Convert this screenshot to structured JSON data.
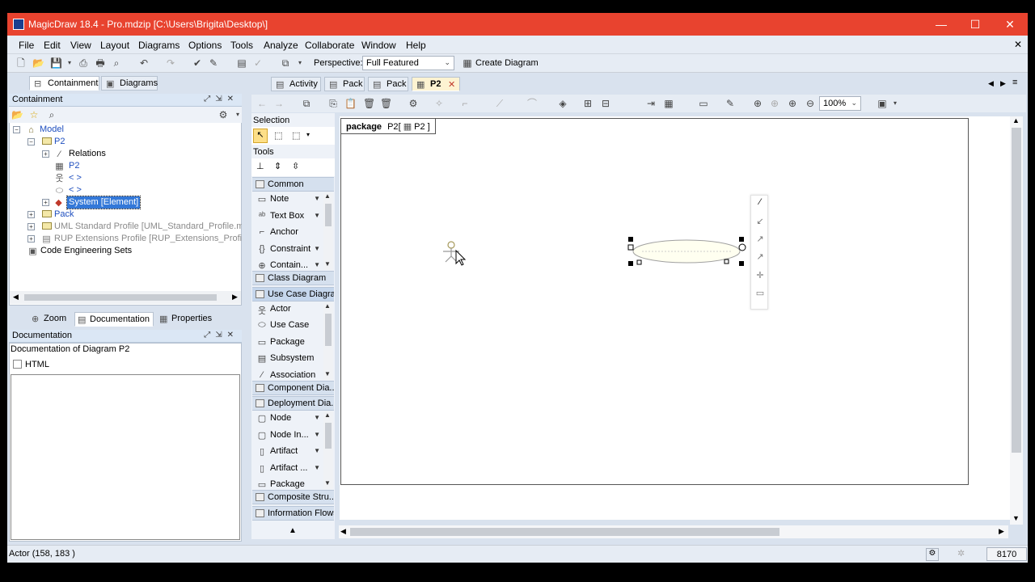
{
  "window": {
    "title": "MagicDraw 18.4 - Pro.mdzip [C:\\Users\\Brigita\\Desktop\\]",
    "minimize": "—",
    "maximize": "☐",
    "close": "✕"
  },
  "menubar": {
    "items": [
      "File",
      "Edit",
      "View",
      "Layout",
      "Diagrams",
      "Options",
      "Tools",
      "Analyze",
      "Collaborate",
      "Window",
      "Help"
    ],
    "close": "✕"
  },
  "toolbar": {
    "perspective_label": "Perspective:",
    "perspective_value": "Full Featured",
    "create_diagram_label": "Create Diagram"
  },
  "left_tabs": {
    "containment": "Containment",
    "diagrams": "Diagrams"
  },
  "containment": {
    "header": "Containment",
    "tree": [
      {
        "label": "Model"
      },
      {
        "label": "P2"
      },
      {
        "label": "Relations"
      },
      {
        "label": "P2"
      },
      {
        "label": "< >"
      },
      {
        "label": "< >"
      },
      {
        "label": "System [Element]"
      },
      {
        "label": "Pack"
      },
      {
        "label": "UML Standard Profile [UML_Standard_Profile.mdzip]"
      },
      {
        "label": "RUP Extensions Profile [RUP_Extensions_Profile.mdzip]"
      },
      {
        "label": "Code Engineering Sets"
      }
    ]
  },
  "bottom_tabs": {
    "zoom": "Zoom",
    "documentation": "Documentation",
    "properties": "Properties"
  },
  "documentation": {
    "header": "Documentation",
    "subtitle": "Documentation of Diagram P2",
    "html_label": "HTML"
  },
  "diagram_tabs": [
    {
      "label": "Activity"
    },
    {
      "label": "Pack"
    },
    {
      "label": "Pack"
    },
    {
      "label": "P2"
    }
  ],
  "diagram_tab_close": "✕",
  "zoom_value": "100%",
  "palette": {
    "selection_label": "Selection",
    "tools_label": "Tools",
    "groups": {
      "common": "Common",
      "class_diagram": "Class Diagram",
      "use_case_diagram": "Use Case Diagram",
      "component": "Component Dia...",
      "deployment": "Deployment Dia...",
      "composite": "Composite Stru...",
      "info_flows": "Information Flows"
    },
    "common_items": [
      "Note",
      "Text Box",
      "Anchor",
      "Constraint",
      "Contain..."
    ],
    "use_case_items": [
      "Actor",
      "Use Case",
      "Package",
      "Subsystem",
      "Association"
    ],
    "deployment_items": [
      "Node",
      "Node In...",
      "Artifact",
      "Artifact ...",
      "Package"
    ]
  },
  "diagram": {
    "frame_kind": "package",
    "frame_name": "P2",
    "frame_tab_inner": "P2"
  },
  "statusbar": {
    "text": "Actor (158, 183 )",
    "memory": "8170"
  }
}
